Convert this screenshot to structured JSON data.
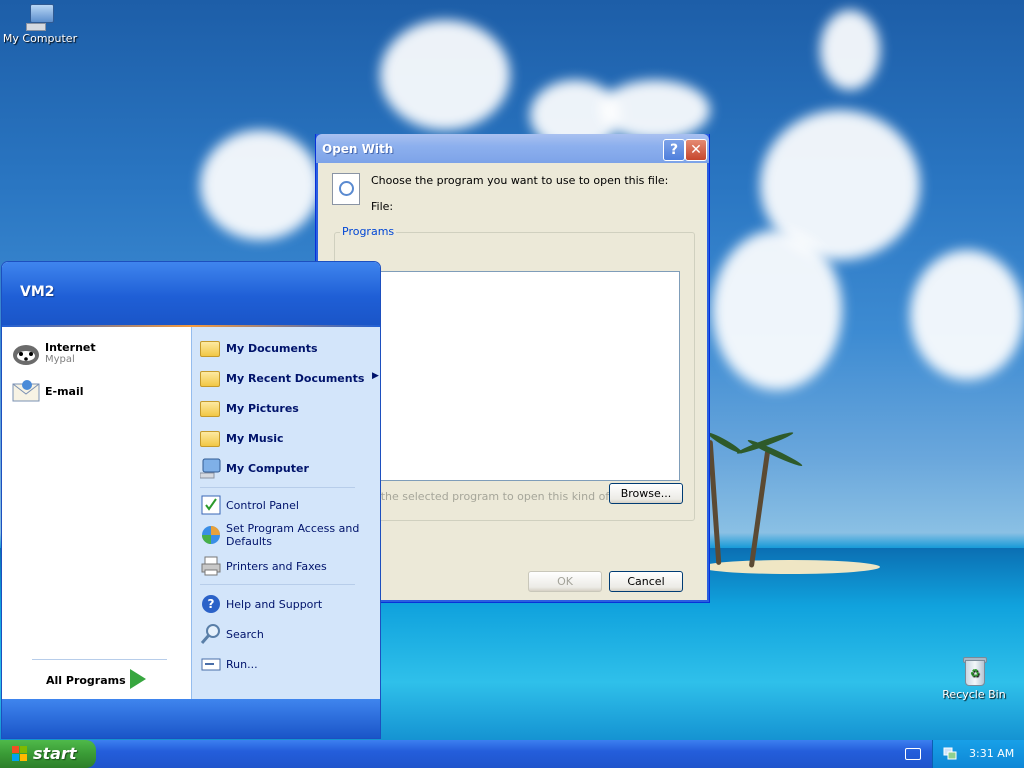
{
  "desktop": {
    "icons": [
      {
        "label": "My Computer",
        "icon": "computer-icon"
      },
      {
        "label": "Recycle Bin",
        "icon": "recycle-bin-icon"
      }
    ]
  },
  "dialog": {
    "title": "Open With",
    "help_label": "?",
    "close_label": "✕",
    "prompt": "Choose the program you want to use to open this file:",
    "file_label": "File:",
    "group_label": "Programs",
    "checkbox_label": "ys use the selected program to open this kind of file",
    "browse_label": "Browse...",
    "ok_label": "OK",
    "cancel_label": "Cancel"
  },
  "startmenu": {
    "user": "VM2",
    "pinned": [
      {
        "label": "Internet",
        "sub": "Mypal",
        "icon": "browser-icon"
      },
      {
        "label": "E-mail",
        "icon": "email-icon"
      }
    ],
    "all_programs": "All Programs",
    "places": [
      {
        "label": "My Documents",
        "icon": "documents-folder-icon"
      },
      {
        "label": "My Recent Documents",
        "icon": "recent-folder-icon",
        "arrow": "▶"
      },
      {
        "label": "My Pictures",
        "icon": "pictures-folder-icon"
      },
      {
        "label": "My Music",
        "icon": "music-folder-icon"
      },
      {
        "label": "My Computer",
        "icon": "computer-icon"
      }
    ],
    "settings": [
      {
        "label": "Control Panel",
        "icon": "control-panel-icon"
      },
      {
        "label": "Set Program Access and Defaults",
        "icon": "program-access-icon"
      },
      {
        "label": "Printers and Faxes",
        "icon": "printer-icon"
      }
    ],
    "tools": [
      {
        "label": "Help and Support",
        "icon": "help-icon"
      },
      {
        "label": "Search",
        "icon": "search-icon"
      },
      {
        "label": "Run...",
        "icon": "run-icon"
      }
    ]
  },
  "taskbar": {
    "start_label": "start",
    "clock": "3:31 AM"
  },
  "colors": {
    "taskbar": "#245edb",
    "start_green": "#3a9b36",
    "dialog_face": "#ece9d8",
    "startmenu_right": "#d3e5fa"
  }
}
